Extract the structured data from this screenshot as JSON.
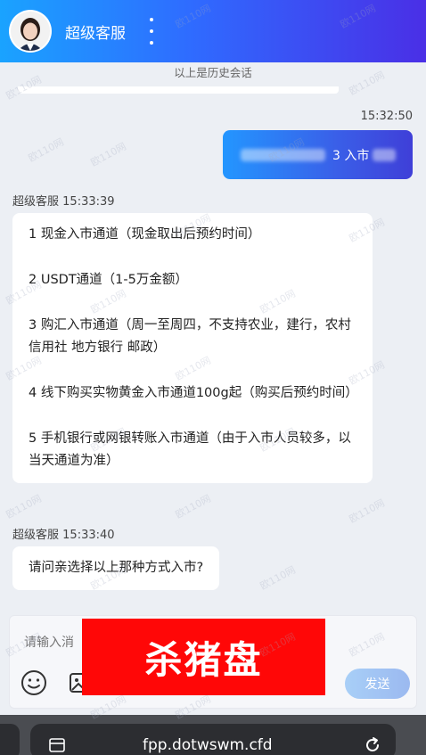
{
  "header": {
    "agent_name": "超级客服"
  },
  "history_divider": "以上是历史会话",
  "messages": [
    {
      "direction": "sent",
      "time": "15:32:50",
      "text": "3 入市"
    },
    {
      "direction": "received",
      "sender": "超级客服",
      "time": "15:33:39",
      "lines": [
        "1 现金入市通道（现金取出后预约时间）",
        "2 USDT通道（1-5万金额）",
        "3 购汇入市通道（周一至周四，不支持农业，建行，农村信用社 地方银行 邮政）",
        "4 线下购买实物黄金入市通道100g起（购买后预约时间）",
        "5 手机银行或网银转账入市通道（由于入市人员较多，以当天通道为准）"
      ]
    },
    {
      "direction": "received",
      "sender": "超级客服",
      "time": "15:33:40",
      "text": "请问亲选择以上那种方式入市?"
    }
  ],
  "composer": {
    "placeholder": "请输入消",
    "send_label": "发送"
  },
  "banner": {
    "text": "杀猪盘",
    "color": "#ff0707"
  },
  "browser": {
    "url": "fpp.dotwswm.cfd"
  },
  "watermark": "欧110网",
  "colors": {
    "header_start": "#1aa3ff",
    "header_end": "#4a2fe6",
    "sent_bubble": "#2f6bff"
  }
}
